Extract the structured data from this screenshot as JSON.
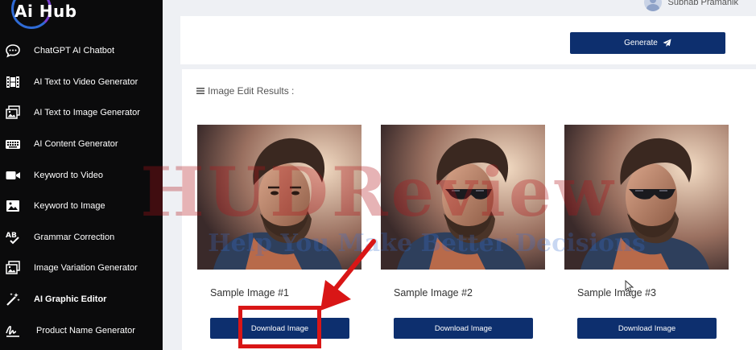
{
  "app": {
    "logo_text": "Ai Hub"
  },
  "sidebar": {
    "items": [
      {
        "label": "ChatGPT AI Chatbot",
        "icon": "chat-bubble-icon"
      },
      {
        "label": "AI Text to Video Generator",
        "icon": "film-icon"
      },
      {
        "label": "AI Text to Image Generator",
        "icon": "images-icon"
      },
      {
        "label": "AI Content Generator",
        "icon": "keyboard-icon"
      },
      {
        "label": "Keyword to Video",
        "icon": "video-camera-icon"
      },
      {
        "label": "Keyword to Image",
        "icon": "image-icon"
      },
      {
        "label": "Grammar Correction",
        "icon": "spell-check-icon"
      },
      {
        "label": "Image Variation Generator",
        "icon": "images-icon"
      },
      {
        "label": "AI Graphic Editor",
        "icon": "magic-wand-icon",
        "active": true
      },
      {
        "label": "Product Name Generator",
        "icon": "signature-icon"
      }
    ]
  },
  "header": {
    "user_name": "Subhab Pramanik"
  },
  "generate": {
    "button_label": "Generate"
  },
  "results": {
    "title": "Image Edit Results :",
    "cards": [
      {
        "label": "Sample Image #1",
        "button_label": "Download Image",
        "sunglasses": false
      },
      {
        "label": "Sample Image #2",
        "button_label": "Download Image",
        "sunglasses": true
      },
      {
        "label": "Sample Image #3",
        "button_label": "Download Image",
        "sunglasses": true
      }
    ]
  },
  "watermark": {
    "line1": "HUDReview",
    "line2": "Help You Make Better Decisions"
  },
  "colors": {
    "sidebar_bg": "#0b0b0c",
    "button_bg": "#0d2f6e",
    "highlight": "#d91616"
  }
}
